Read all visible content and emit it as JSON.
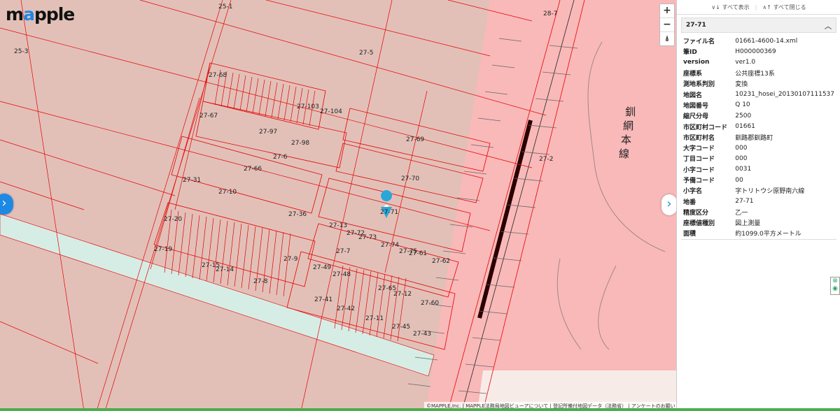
{
  "app": {
    "logo_prefix": "m",
    "logo_o": "a",
    "logo_suffix": "pple"
  },
  "map": {
    "zoom_in": "+",
    "zoom_out": "−",
    "reset_north": "⍋",
    "toggle_left_icon": "›",
    "toggle_right_icon": "›",
    "rail_label": "釧網本線",
    "labels": [
      {
        "t": "25-1"
      },
      {
        "t": "25-3"
      },
      {
        "t": "27-5"
      },
      {
        "t": "28-7"
      },
      {
        "t": "27-68"
      },
      {
        "t": "27-104"
      },
      {
        "t": "27-103"
      },
      {
        "t": "27-67"
      },
      {
        "t": "27-97"
      },
      {
        "t": "27-98"
      },
      {
        "t": "27-69"
      },
      {
        "t": "27-6"
      },
      {
        "t": "27-66"
      },
      {
        "t": "27-2"
      },
      {
        "t": "27-70"
      },
      {
        "t": "27-31"
      },
      {
        "t": "27-10"
      },
      {
        "t": "27-36"
      },
      {
        "t": "27-71"
      },
      {
        "t": "27-13"
      },
      {
        "t": "27-20"
      },
      {
        "t": "27-72"
      },
      {
        "t": "27-73"
      },
      {
        "t": "27-74"
      },
      {
        "t": "27-75"
      },
      {
        "t": "27-61"
      },
      {
        "t": "27-19"
      },
      {
        "t": "27-9"
      },
      {
        "t": "27-7"
      },
      {
        "t": "27-62"
      },
      {
        "t": "27-15"
      },
      {
        "t": "27-14"
      },
      {
        "t": "27-49"
      },
      {
        "t": "27-48"
      },
      {
        "t": "27-8"
      },
      {
        "t": "27-65"
      },
      {
        "t": "27-12"
      },
      {
        "t": "27-41"
      },
      {
        "t": "27-60"
      },
      {
        "t": "27-42"
      },
      {
        "t": "27-11"
      },
      {
        "t": "27-45"
      },
      {
        "t": "27-43"
      }
    ],
    "copyright": "©MAPPLE,Inc. | MAPPLE法務局地図ビューアについて | 登記所備付地図データ（法務省） | アンケートのお願い"
  },
  "panel": {
    "expand_all": "∨↓ すべて表示",
    "collapse_all": "∧↑ すべて閉じる",
    "section_title": "27-71",
    "section_chevron": "︿",
    "rows": [
      {
        "k": "ファイル名",
        "v": "01661-4600-14.xml"
      },
      {
        "k": "筆ID",
        "v": "H000000369"
      },
      {
        "k": "version",
        "v": "ver1.0"
      },
      {
        "k": "座標系",
        "v": "公共座標13系"
      },
      {
        "k": "測地系判別",
        "v": "変換"
      },
      {
        "k": "地図名",
        "v": "10231_hosei_20130107111537"
      },
      {
        "k": "地図番号",
        "v": "Q 10"
      },
      {
        "k": "縮尺分母",
        "v": "2500"
      },
      {
        "k": "市区町村コード",
        "v": "01661"
      },
      {
        "k": "市区町村名",
        "v": "釧路郡釧路町"
      },
      {
        "k": "大字コード",
        "v": "000"
      },
      {
        "k": "丁目コード",
        "v": "000"
      },
      {
        "k": "小字コード",
        "v": "0031"
      },
      {
        "k": "予備コード",
        "v": "00"
      },
      {
        "k": "小字名",
        "v": "字トリトウシ原野南六線"
      },
      {
        "k": "地番",
        "v": "27-71"
      },
      {
        "k": "精度区分",
        "v": "乙一"
      },
      {
        "k": "座標値種別",
        "v": "図上測量"
      },
      {
        "k": "面積",
        "v": "約1099.0平方メートル"
      }
    ]
  },
  "colors": {
    "parcel": "#e2c0b8",
    "rail_zone": "#f9b9b9",
    "road": "#d6ede6",
    "line": "#e60000",
    "accent": "#1e88e5"
  }
}
